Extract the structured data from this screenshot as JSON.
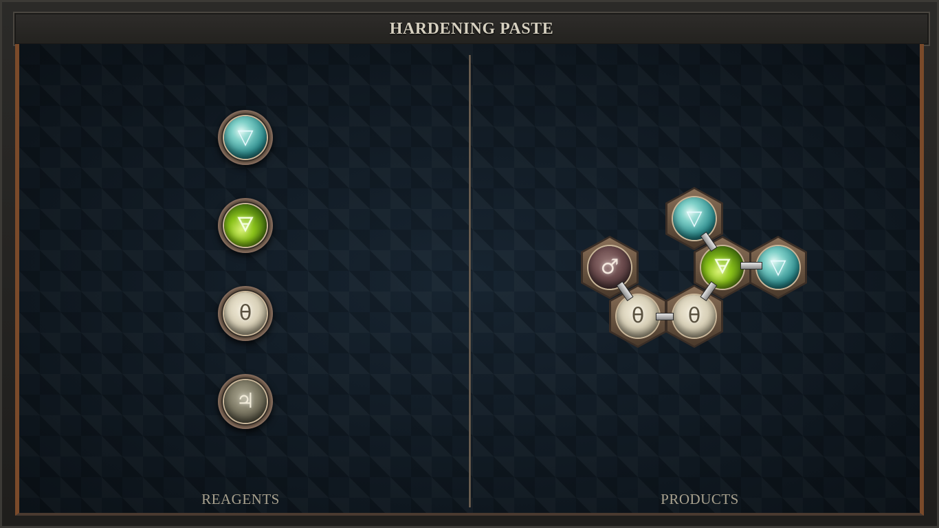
{
  "title": "HARDENING PASTE",
  "panels": {
    "reagents_label": "REAGENTS",
    "products_label": "PRODUCTS"
  },
  "reagents": [
    {
      "element": "water",
      "glyph": "▽"
    },
    {
      "element": "earth",
      "glyph": "🜃"
    },
    {
      "element": "salt",
      "glyph": "θ"
    },
    {
      "element": "quicksilver",
      "glyph": "♃"
    }
  ],
  "product": {
    "atoms": [
      {
        "element": "iron",
        "glyph": "♂"
      },
      {
        "element": "salt",
        "glyph": "θ"
      },
      {
        "element": "salt",
        "glyph": "θ"
      },
      {
        "element": "earth",
        "glyph": "🜃"
      },
      {
        "element": "water",
        "glyph": "▽"
      },
      {
        "element": "water",
        "glyph": "▽"
      }
    ]
  },
  "colors": {
    "frame": "#2b2a28",
    "board": "#14202b",
    "copper_trim": "#7a4a2a",
    "label_text": "#a9a28f",
    "title_text": "#d6d0c0"
  }
}
